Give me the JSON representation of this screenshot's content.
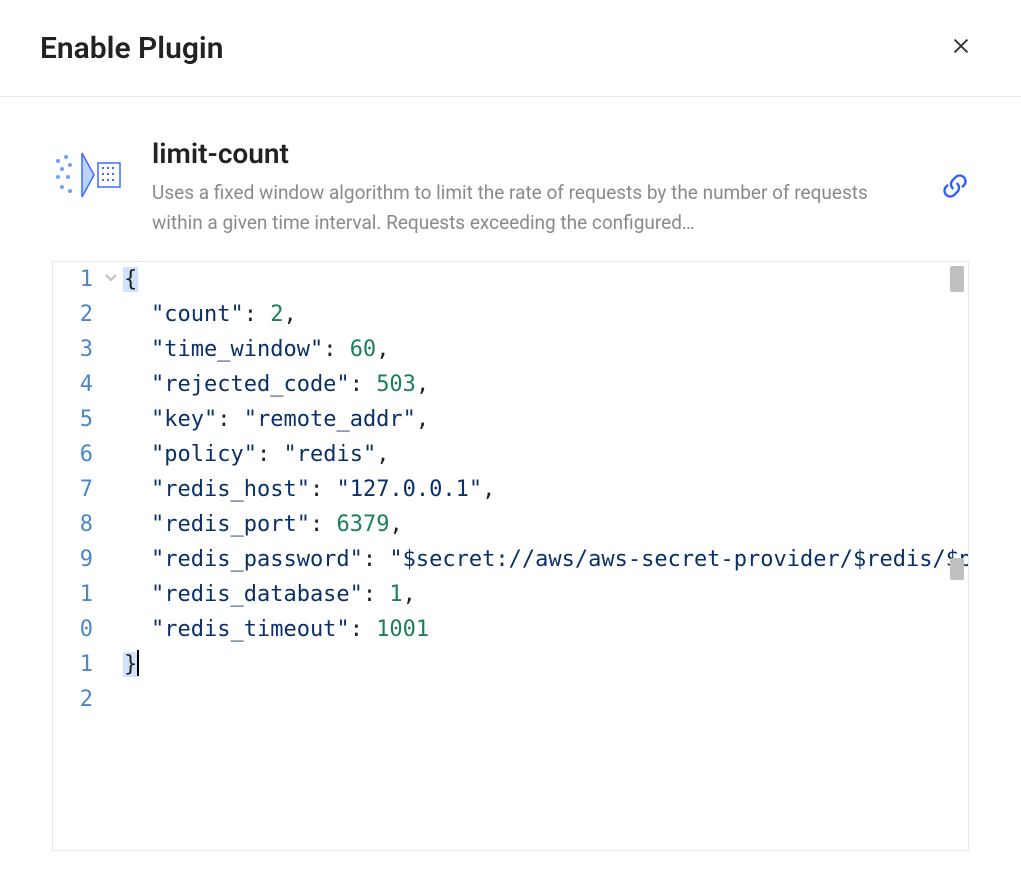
{
  "modal": {
    "title": "Enable Plugin"
  },
  "plugin": {
    "name": "limit-count",
    "description": "Uses a fixed window algorithm to limit the rate of requests by the number of requests within a given time interval. Requests exceeding the configured…"
  },
  "editor": {
    "gutter": [
      "1",
      "2",
      "3",
      "4",
      "5",
      "6",
      "7",
      "8",
      "9",
      "1",
      "0",
      "1",
      "2"
    ],
    "lines": [
      {
        "tokens": [
          {
            "t": "{",
            "c": "punc",
            "sel": true
          }
        ]
      },
      {
        "indent": 1,
        "tokens": [
          {
            "t": "\"count\"",
            "c": "key"
          },
          {
            "t": ": ",
            "c": "punc"
          },
          {
            "t": "2",
            "c": "num"
          },
          {
            "t": ",",
            "c": "punc"
          }
        ]
      },
      {
        "indent": 1,
        "tokens": [
          {
            "t": "\"time_window\"",
            "c": "key"
          },
          {
            "t": ": ",
            "c": "punc"
          },
          {
            "t": "60",
            "c": "num"
          },
          {
            "t": ",",
            "c": "punc"
          }
        ]
      },
      {
        "indent": 1,
        "tokens": [
          {
            "t": "\"rejected_code\"",
            "c": "key"
          },
          {
            "t": ": ",
            "c": "punc"
          },
          {
            "t": "503",
            "c": "num"
          },
          {
            "t": ",",
            "c": "punc"
          }
        ]
      },
      {
        "indent": 1,
        "tokens": [
          {
            "t": "\"key\"",
            "c": "key"
          },
          {
            "t": ": ",
            "c": "punc"
          },
          {
            "t": "\"remote_addr\"",
            "c": "str"
          },
          {
            "t": ",",
            "c": "punc"
          }
        ]
      },
      {
        "indent": 1,
        "tokens": [
          {
            "t": "\"policy\"",
            "c": "key"
          },
          {
            "t": ": ",
            "c": "punc"
          },
          {
            "t": "\"redis\"",
            "c": "str"
          },
          {
            "t": ",",
            "c": "punc"
          }
        ]
      },
      {
        "indent": 1,
        "tokens": [
          {
            "t": "\"redis_host\"",
            "c": "key"
          },
          {
            "t": ": ",
            "c": "punc"
          },
          {
            "t": "\"127.0.0.1\"",
            "c": "str"
          },
          {
            "t": ",",
            "c": "punc"
          }
        ]
      },
      {
        "indent": 1,
        "tokens": [
          {
            "t": "\"redis_port\"",
            "c": "key"
          },
          {
            "t": ": ",
            "c": "punc"
          },
          {
            "t": "6379",
            "c": "num"
          },
          {
            "t": ",",
            "c": "punc"
          }
        ]
      },
      {
        "indent": 1,
        "tokens": [
          {
            "t": "\"redis_password\"",
            "c": "key"
          },
          {
            "t": ": ",
            "c": "punc"
          },
          {
            "t": "\"$secret://aws/aws-secret-provider/$redis/$passwor",
            "c": "str"
          }
        ]
      },
      {
        "indent": 1,
        "tokens": [
          {
            "t": "\"redis_database\"",
            "c": "key"
          },
          {
            "t": ": ",
            "c": "punc"
          },
          {
            "t": "1",
            "c": "num"
          },
          {
            "t": ",",
            "c": "punc"
          }
        ]
      },
      {
        "indent": 1,
        "tokens": [
          {
            "t": "\"redis_timeout\"",
            "c": "key"
          },
          {
            "t": ": ",
            "c": "punc"
          },
          {
            "t": "1001",
            "c": "num"
          }
        ]
      },
      {
        "tokens": [
          {
            "t": "}",
            "c": "punc",
            "sel": true,
            "cursor": true
          }
        ]
      },
      {
        "tokens": []
      }
    ],
    "json_value": {
      "count": 2,
      "time_window": 60,
      "rejected_code": 503,
      "key": "remote_addr",
      "policy": "redis",
      "redis_host": "127.0.0.1",
      "redis_port": 6379,
      "redis_password": "$secret://aws/aws-secret-provider/$redis/$password",
      "redis_database": 1,
      "redis_timeout": 1001
    }
  }
}
